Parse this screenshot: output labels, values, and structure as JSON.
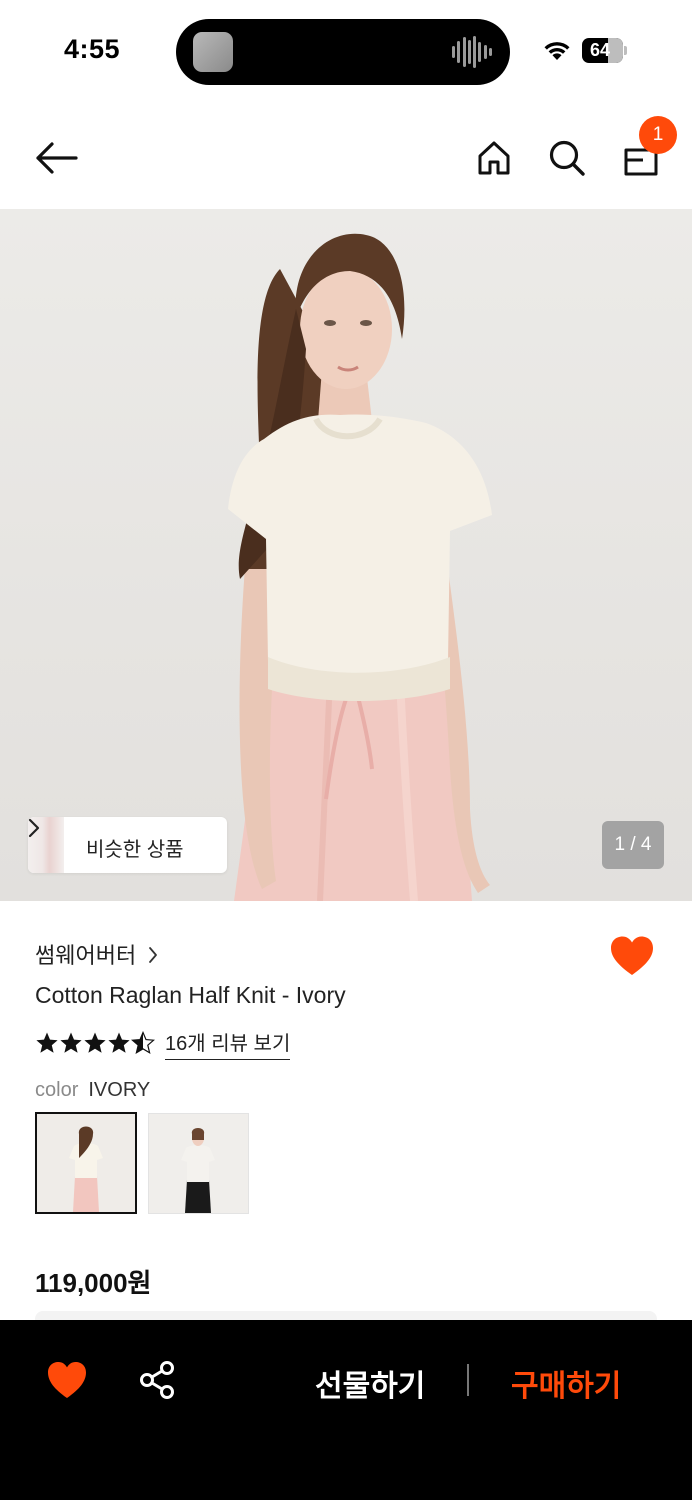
{
  "status_bar": {
    "time": "4:55",
    "battery_level": "64",
    "battery_fraction": 0.64
  },
  "nav": {
    "back_icon": "arrow-left-icon",
    "home_icon": "home-icon",
    "search_icon": "search-icon",
    "cart_icon": "shopping-bag-icon",
    "cart_count": "1"
  },
  "gallery": {
    "similar_label": "비슷한 상품",
    "pager": "1 / 4",
    "current_page": 1,
    "total_pages": 4
  },
  "product": {
    "brand": "썸웨어버터",
    "title": "Cotton Raglan Half Knit - Ivory",
    "rating": 4.5,
    "review_link": "16개 리뷰 보기",
    "color_key": "color",
    "color_value": "IVORY",
    "swatch_count": 2,
    "selected_swatch": 1,
    "price": "119,000원",
    "wishlisted": true
  },
  "bottom_bar": {
    "gift_label": "선물하기",
    "buy_label": "구매하기"
  },
  "colors": {
    "accent": "#ff4a0a",
    "bottom_bar_bg": "#000000",
    "pager_bg": "#a3a3a3"
  }
}
